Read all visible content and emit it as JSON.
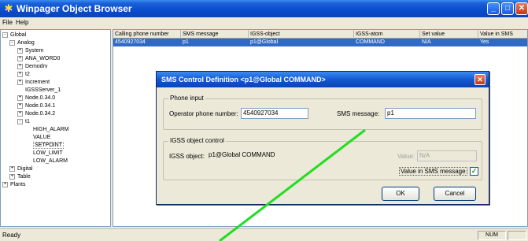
{
  "window": {
    "title": "Winpager Object Browser",
    "icon": "winpager-app-icon",
    "controls": [
      "minimize",
      "maximize",
      "close"
    ]
  },
  "menu": [
    "File",
    "Help"
  ],
  "tree": {
    "rows": [
      {
        "label": "Global",
        "expander": "-"
      },
      {
        "label": "Analog",
        "expander": "-"
      },
      {
        "label": "System",
        "expander": "+"
      },
      {
        "label": "ANA_WORD0",
        "expander": "+"
      },
      {
        "label": "Demodrv",
        "expander": "+"
      },
      {
        "label": "t2",
        "expander": "+"
      },
      {
        "label": "Increment",
        "expander": "+"
      },
      {
        "label": "IGSSServer_1",
        "expander": ""
      },
      {
        "label": "Node.0.34.0",
        "expander": "+"
      },
      {
        "label": "Node.0.34.1",
        "expander": "+"
      },
      {
        "label": "Node.0.34.2",
        "expander": "+"
      },
      {
        "label": "t1",
        "expander": "-"
      },
      {
        "label": "HIGH_ALARM",
        "expander": ""
      },
      {
        "label": "VALUE",
        "expander": ""
      },
      {
        "label": "SETPOINT",
        "expander": "",
        "selected": true
      },
      {
        "label": "LOW_LIMIT",
        "expander": ""
      },
      {
        "label": "LOW_ALARM",
        "expander": ""
      },
      {
        "label": "Digital",
        "expander": "+"
      },
      {
        "label": "Table",
        "expander": "+"
      },
      {
        "label": "Plants",
        "expander": "+"
      }
    ]
  },
  "grid": {
    "headers": [
      "Calling phone number",
      "SMS message",
      "IGSS-object",
      "IGSS-atom",
      "Set value",
      "Value in SMS"
    ],
    "rows": [
      {
        "phone": "4540927034",
        "sms": "p1",
        "object": "p1@Global",
        "atom": "COMMAND",
        "set_value": "N/A",
        "value_in_sms": "Yes",
        "selected": true
      }
    ]
  },
  "status": {
    "text": "Ready",
    "panes": [
      "NUM",
      ""
    ]
  },
  "dialog": {
    "title": "SMS Control Definition   <p1@Global COMMAND>",
    "phone_group": {
      "title": "Phone input",
      "operator_label": "Operator phone number:",
      "operator_value": "4540927034",
      "sms_label": "SMS message:",
      "sms_value": "p1"
    },
    "igss_group": {
      "title": "IGSS object control",
      "object_label": "IGSS object:",
      "object_value": "p1@Global COMMAND",
      "value_label": "Value:",
      "value_value": "N/A",
      "value_in_sms_label": "Value in SMS message",
      "value_in_sms_checked": true
    },
    "ok_label": "OK",
    "cancel_label": "Cancel"
  },
  "colors": {
    "titlebar": "#0a4ccc",
    "selection": "#316ac5",
    "annotation_line": "#22dd22"
  }
}
